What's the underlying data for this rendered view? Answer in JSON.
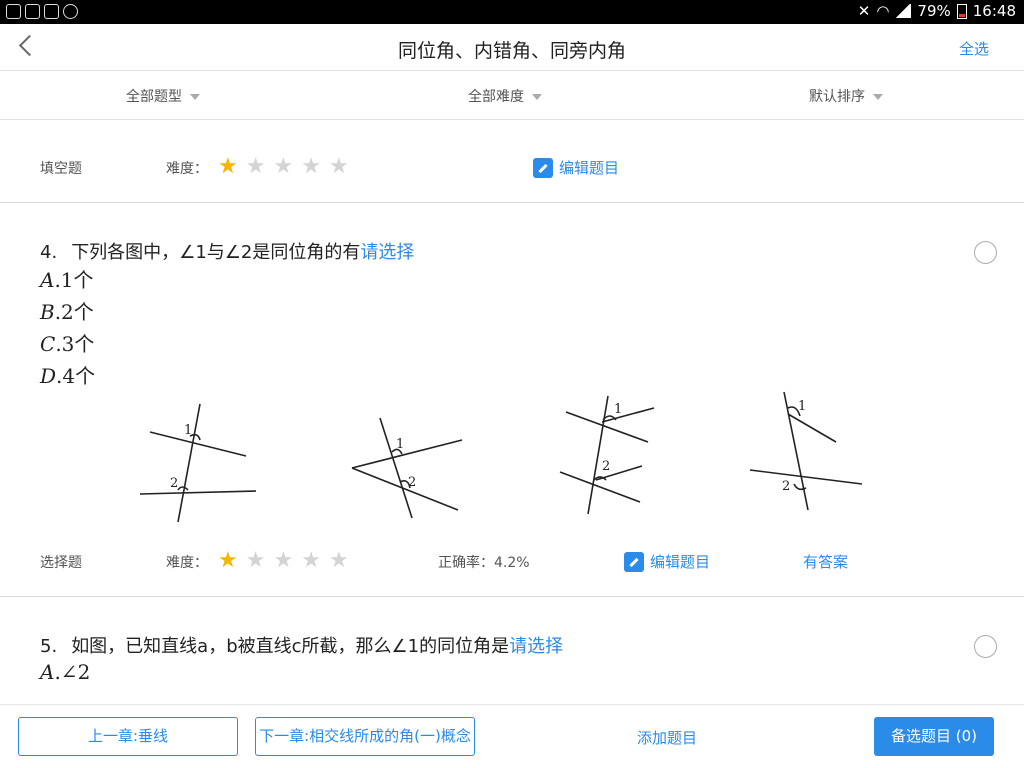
{
  "status": {
    "percent": "79%",
    "time": "16:48"
  },
  "header": {
    "title": "同位角、内错角、同旁内角",
    "select_all": "全选"
  },
  "filters": [
    {
      "label": "全部题型"
    },
    {
      "label": "全部难度"
    },
    {
      "label": "默认排序"
    }
  ],
  "q3": {
    "type": "填空题",
    "difficulty_label": "难度：",
    "difficulty": 1,
    "edit": "编辑题目"
  },
  "q4": {
    "number": "4.",
    "stem_a": "下列各图中，",
    "stem_b": "∠1与∠2是同位角的有",
    "choose": "请选择",
    "options": [
      {
        "letter": "A",
        "text": ".1个"
      },
      {
        "letter": "B",
        "text": ".2个"
      },
      {
        "letter": "C",
        "text": ".3个"
      },
      {
        "letter": "D",
        "text": ".4个"
      }
    ],
    "figure_labels": [
      "1",
      "2"
    ],
    "type": "选择题",
    "difficulty_label": "难度：",
    "difficulty": 1,
    "accuracy": "正确率：4.2%",
    "edit": "编辑题目",
    "answer": "有答案"
  },
  "q5": {
    "number": "5.",
    "stem": "如图，已知直线a，b被直线c所截，那么∠1的同位角是",
    "choose": "请选择",
    "option_a_letter": "A",
    "option_a_text": ".∠2"
  },
  "bottom": {
    "prev": "上一章:垂线",
    "next": "下一章:相交线所成的角(一)概念",
    "add": "添加题目",
    "selected": "备选题目 (0)"
  }
}
